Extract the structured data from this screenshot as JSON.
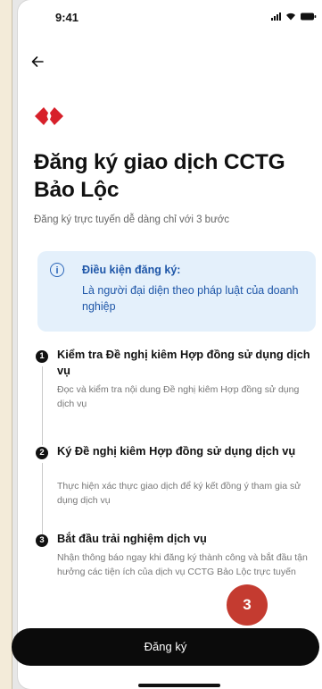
{
  "status_bar": {
    "time": "9:41"
  },
  "header": {
    "back_icon": "arrow-left-icon"
  },
  "brand": {
    "logo_icon": "red-diamond-logo",
    "color": "#d7202a"
  },
  "page": {
    "title": "Đăng ký giao dịch CCTG Bảo Lộc",
    "subtitle": "Đăng ký trực tuyến dễ dàng chỉ với 3 bước"
  },
  "info": {
    "icon": "info-icon",
    "title": "Điều kiện đăng ký:",
    "text": "Là người đại diện theo pháp luật của doanh nghiệp"
  },
  "steps": [
    {
      "num": "1",
      "title": "Kiểm tra Đề nghị kiêm Hợp đồng sử dụng dịch vụ",
      "desc": "Đọc và kiểm tra nội dung Đề nghị kiêm Hợp đồng sử dụng dịch vụ"
    },
    {
      "num": "2",
      "title": "Ký Đề nghị kiêm Hợp đồng sử dụng dịch vụ",
      "desc": "Thực hiện xác thực giao dịch để ký kết đồng ý tham gia sử dụng dịch vụ"
    },
    {
      "num": "3",
      "title": "Bắt đầu trải nghiệm dịch vụ",
      "desc": "Nhận thông báo ngay khi đăng ký thành công và bắt đầu tận hưởng các tiện ích của dịch vụ CCTG Bảo Lộc trực tuyến"
    }
  ],
  "cta": {
    "label": "Đăng ký"
  },
  "annotation": {
    "label": "3",
    "color": "#c43b30"
  }
}
